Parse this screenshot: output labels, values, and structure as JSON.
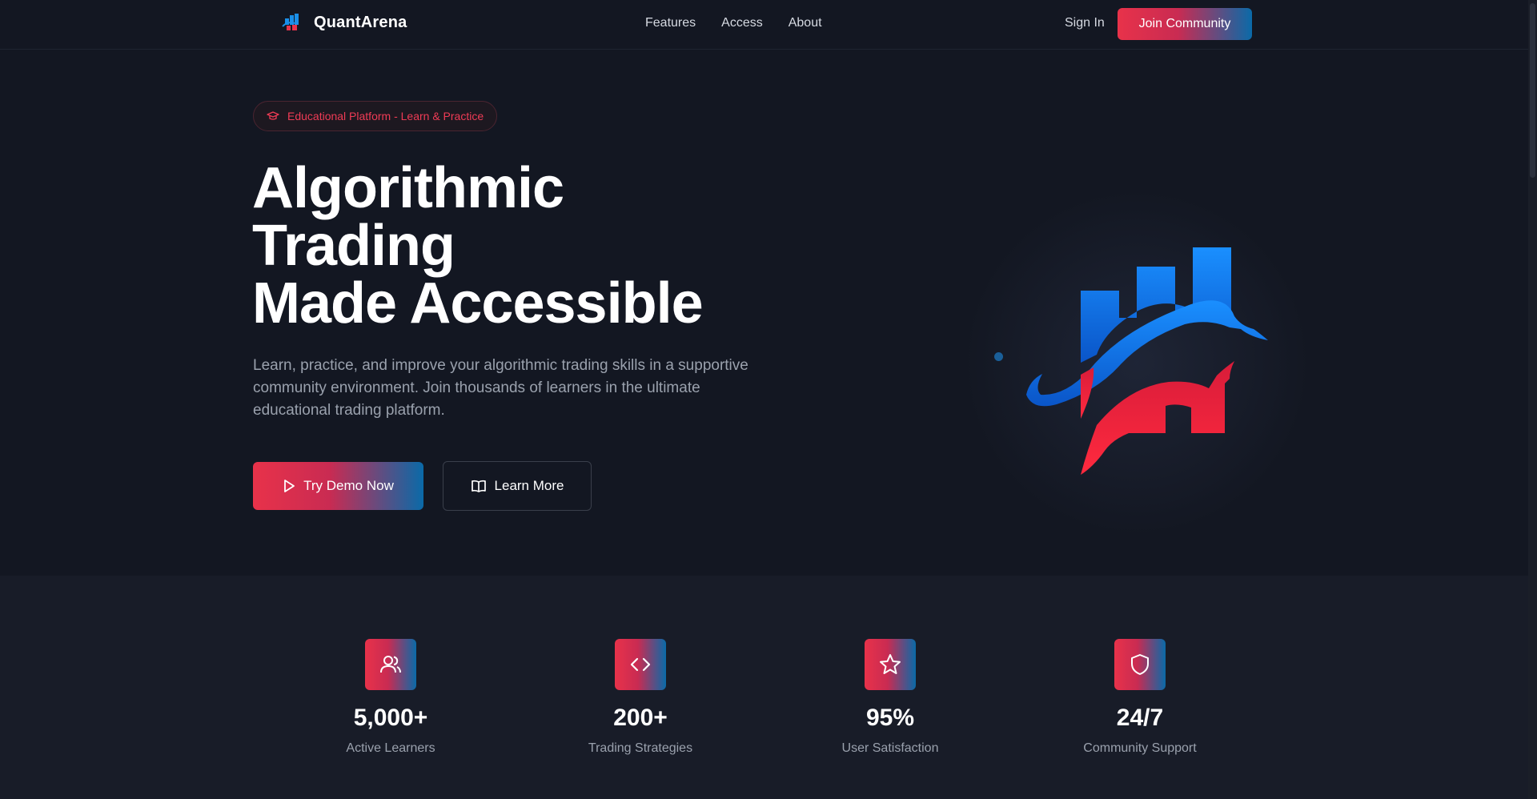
{
  "nav": {
    "brand": "QuantArena",
    "links": [
      "Features",
      "Access",
      "About"
    ],
    "sign_in": "Sign In",
    "join": "Join Community"
  },
  "hero": {
    "badge": "Educational Platform - Learn & Practice",
    "headline": [
      "Algorithmic",
      "Trading",
      "Made Accessible"
    ],
    "subtext": "Learn, practice, and improve your algorithmic trading skills in a supportive community environment. Join thousands of learners in the ultimate educational trading platform.",
    "demo_button": "Try Demo Now",
    "learn_button": "Learn More"
  },
  "stats": [
    {
      "value": "5,000+",
      "label": "Active Learners",
      "icon": "users-icon"
    },
    {
      "value": "200+",
      "label": "Trading Strategies",
      "icon": "code-icon"
    },
    {
      "value": "95%",
      "label": "User Satisfaction",
      "icon": "star-icon"
    },
    {
      "value": "24/7",
      "label": "Community Support",
      "icon": "shield-icon"
    }
  ],
  "colors": {
    "background": "#131722",
    "accent_red": "#e8324a",
    "accent_blue": "#0a6aa8",
    "badge_text": "#ef3b55"
  }
}
